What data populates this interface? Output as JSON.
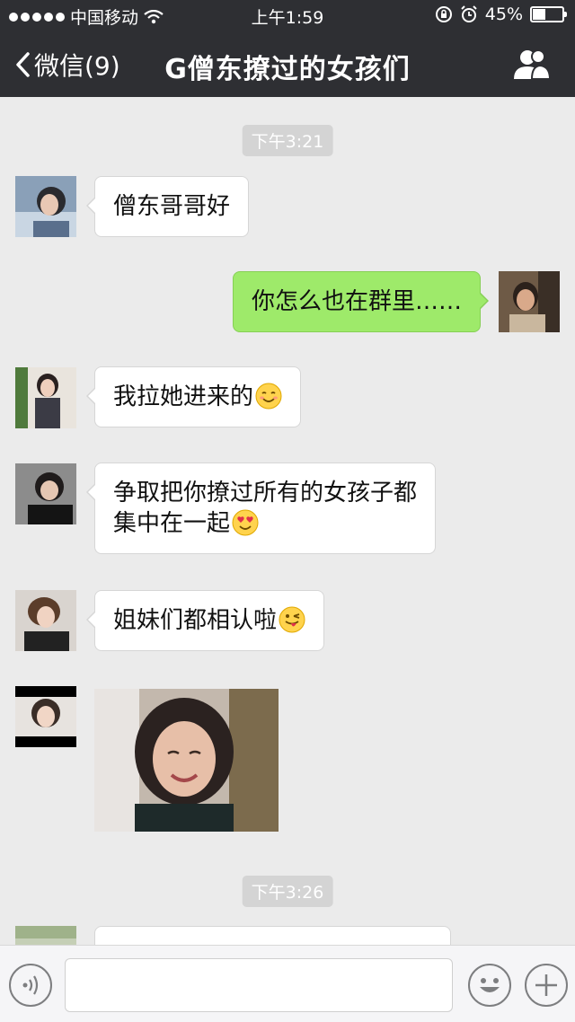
{
  "status_bar": {
    "carrier": "中国移动",
    "time": "上午1:59",
    "battery_text": "45%",
    "battery_level": 0.45
  },
  "nav": {
    "back_label": "微信(9)",
    "title": "G僧东撩过的女孩们",
    "back_icon": "chevron-left-icon",
    "group_icon": "group-members-icon"
  },
  "chat": {
    "timestamps": [
      "下午3:21",
      "下午3:26"
    ],
    "messages": [
      {
        "side": "left",
        "text": "僧东哥哥好"
      },
      {
        "side": "right",
        "text": "你怎么也在群里……"
      },
      {
        "side": "left",
        "text": "我拉她进来的",
        "emoji": "blush-emoji"
      },
      {
        "side": "left",
        "line1": "争取把你撩过所有的女孩子都",
        "line2": "集中在一起",
        "emoji": "heart-eyes-emoji"
      },
      {
        "side": "left",
        "text": "姐妹们都相认啦",
        "emoji": "winking-tongue-emoji"
      },
      {
        "side": "left",
        "type": "image"
      }
    ]
  },
  "input_bar": {
    "voice_icon": "voice-icon",
    "emoji_icon": "smiley-icon",
    "plus_icon": "plus-icon"
  },
  "colors": {
    "nav_bg": "#2e2f33",
    "chat_bg": "#ebebeb",
    "bubble_right": "#9eea6a",
    "bubble_left": "#ffffff"
  }
}
